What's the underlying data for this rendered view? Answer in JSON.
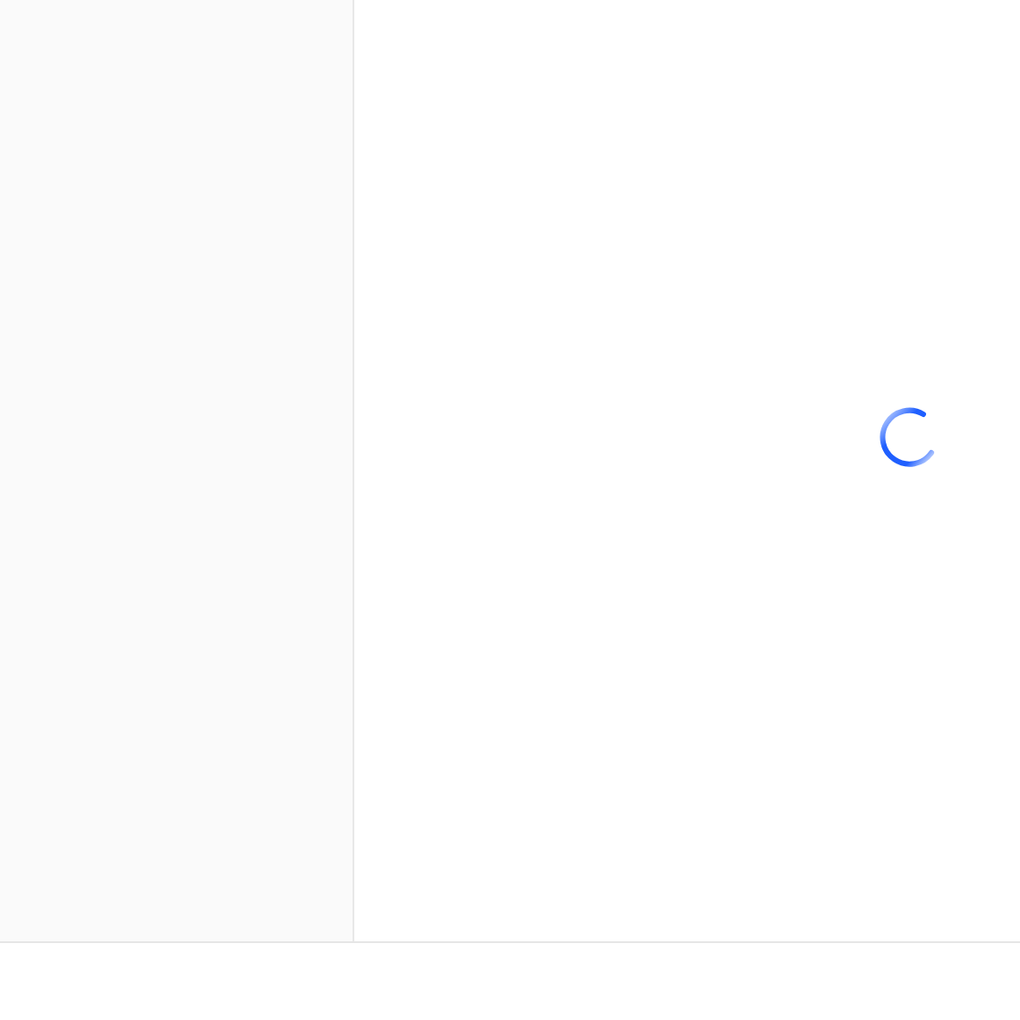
{
  "main": {
    "loading": true
  }
}
